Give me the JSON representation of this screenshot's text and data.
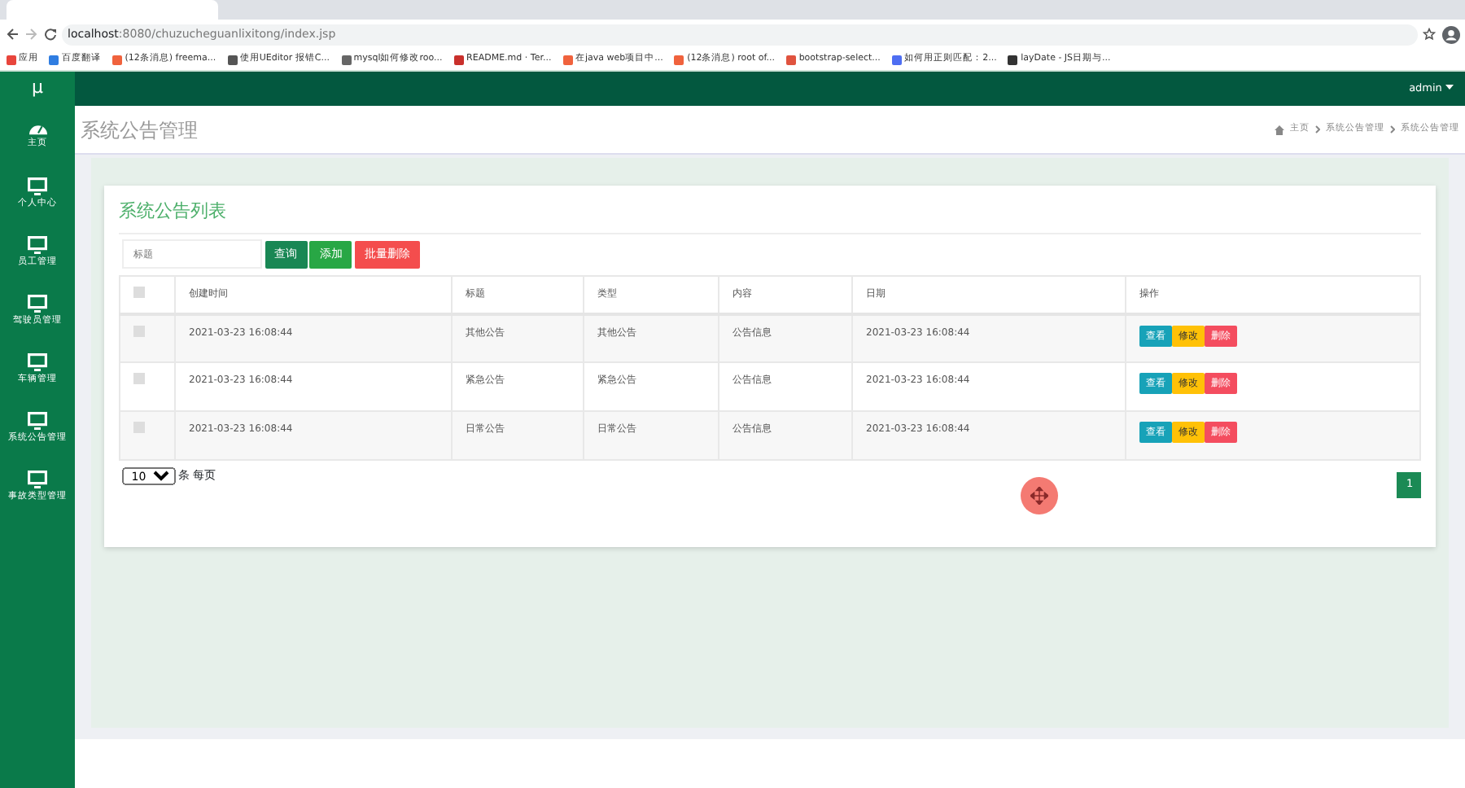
{
  "browser": {
    "host": "localhost",
    "path": ":8080/chuzucheguanlixitong/index.jsp",
    "bookmarks": [
      {
        "label": "应用",
        "color": "#e8453c"
      },
      {
        "label": "百度翻译",
        "color": "#2f7de1"
      },
      {
        "label": "(12条消息) freema...",
        "color": "#f0623d"
      },
      {
        "label": "使用UEditor 报错C...",
        "color": "#555555"
      },
      {
        "label": "mysql如何修改roo...",
        "color": "#666666"
      },
      {
        "label": "README.md · Ter...",
        "color": "#c9302c"
      },
      {
        "label": "在java web项目中...",
        "color": "#f0623d"
      },
      {
        "label": "(12条消息) root of...",
        "color": "#f0623d"
      },
      {
        "label": "bootstrap-select...",
        "color": "#e0533f"
      },
      {
        "label": "如何用正则匹配：2...",
        "color": "#4e6ef2"
      },
      {
        "label": "layDate - JS日期与...",
        "color": "#333333"
      }
    ]
  },
  "logo": "μ",
  "user": "admin",
  "sidebar": {
    "items": [
      {
        "label": "主页",
        "kind": "dashboard"
      },
      {
        "label": "个人中心",
        "kind": "monitor"
      },
      {
        "label": "员工管理",
        "kind": "monitor"
      },
      {
        "label": "驾驶员管理",
        "kind": "monitor"
      },
      {
        "label": "车辆管理",
        "kind": "monitor"
      },
      {
        "label": "系统公告管理",
        "kind": "monitor"
      },
      {
        "label": "事故类型管理",
        "kind": "monitor"
      }
    ]
  },
  "page_title": "系统公告管理",
  "breadcrumb": [
    "主页",
    "系统公告管理",
    "系统公告管理"
  ],
  "card_title": "系统公告列表",
  "search": {
    "placeholder": "标题"
  },
  "toolbar": [
    {
      "label": "查询",
      "kind": "search"
    },
    {
      "label": "添加",
      "kind": "add"
    },
    {
      "label": "批量删除",
      "kind": "delete"
    }
  ],
  "table": {
    "columns": [
      "创建时间",
      "标题",
      "类型",
      "内容",
      "日期",
      "操作"
    ],
    "select_all_checked": false,
    "rows": [
      {
        "checked": false,
        "cells": [
          "2021-03-23 16:08:44",
          "其他公告",
          "其他公告",
          "公告信息",
          "2021-03-23 16:08:44"
        ],
        "actions": [
          {
            "label": "查看",
            "kind": "view"
          },
          {
            "label": "修改",
            "kind": "edit"
          },
          {
            "label": "删除",
            "kind": "delete"
          }
        ]
      },
      {
        "checked": false,
        "cells": [
          "2021-03-23 16:08:44",
          "紧急公告",
          "紧急公告",
          "公告信息",
          "2021-03-23 16:08:44"
        ],
        "actions": [
          {
            "label": "查看",
            "kind": "view"
          },
          {
            "label": "修改",
            "kind": "edit"
          },
          {
            "label": "删除",
            "kind": "delete"
          }
        ]
      },
      {
        "checked": false,
        "cells": [
          "2021-03-23 16:08:44",
          "日常公告",
          "日常公告",
          "公告信息",
          "2021-03-23 16:08:44"
        ],
        "actions": [
          {
            "label": "查看",
            "kind": "view"
          },
          {
            "label": "修改",
            "kind": "edit"
          },
          {
            "label": "删除",
            "kind": "delete"
          }
        ]
      }
    ]
  },
  "page_size": "10",
  "page_size_label": "条 每页",
  "pages": [
    {
      "label": "1",
      "selected": true
    }
  ]
}
